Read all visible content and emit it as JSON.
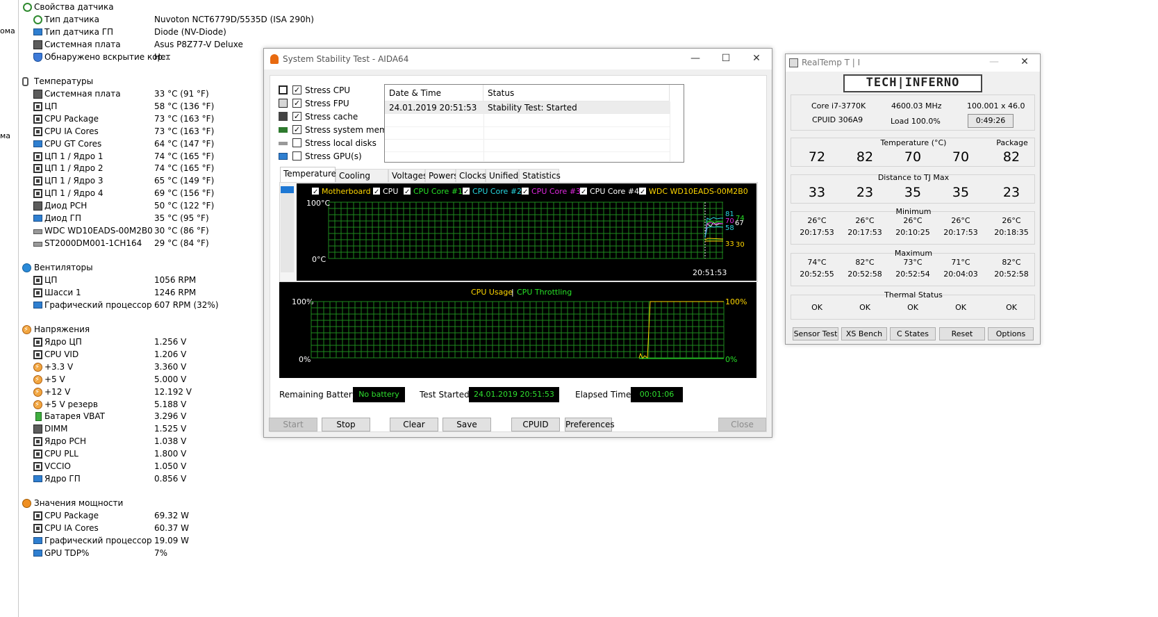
{
  "left_cut": [
    "ома",
    "ма"
  ],
  "sensors": {
    "props_title": "Свойства датчика",
    "props": [
      {
        "label": "Тип датчика",
        "value": "Nuvoton NCT6779D/5535D  (ISA 290h)",
        "icon": "sensor-icon"
      },
      {
        "label": "Тип датчика ГП",
        "value": "Diode  (NV-Diode)",
        "icon": "monitor-icon"
      },
      {
        "label": "Системная плата",
        "value": "Asus P8Z77-V Deluxe",
        "icon": "motherboard-icon"
      },
      {
        "label": "Обнаружено вскрытие кор...",
        "value": "Нет",
        "icon": "shield-icon"
      }
    ],
    "temps_title": "Температуры",
    "temps": [
      {
        "label": "Системная плата",
        "value": "33 °C  (91 °F)"
      },
      {
        "label": "ЦП",
        "value": "58 °C  (136 °F)"
      },
      {
        "label": "CPU Package",
        "value": "73 °C  (163 °F)"
      },
      {
        "label": "CPU IA Cores",
        "value": "73 °C  (163 °F)"
      },
      {
        "label": "CPU GT Cores",
        "value": "64 °C  (147 °F)"
      },
      {
        "label": "ЦП 1 / Ядро 1",
        "value": "74 °C  (165 °F)"
      },
      {
        "label": "ЦП 1 / Ядро 2",
        "value": "74 °C  (165 °F)"
      },
      {
        "label": "ЦП 1 / Ядро 3",
        "value": "65 °C  (149 °F)"
      },
      {
        "label": "ЦП 1 / Ядро 4",
        "value": "69 °C  (156 °F)"
      },
      {
        "label": "Диод PCH",
        "value": "50 °C  (122 °F)"
      },
      {
        "label": "Диод ГП",
        "value": "35 °C  (95 °F)"
      },
      {
        "label": "WDC WD10EADS-00M2B0",
        "value": "30 °C  (86 °F)"
      },
      {
        "label": "ST2000DM001-1CH164",
        "value": "29 °C  (84 °F)"
      }
    ],
    "fans_title": "Вентиляторы",
    "fans": [
      {
        "label": "ЦП",
        "value": "1056 RPM"
      },
      {
        "label": "Шасси 1",
        "value": "1246 RPM"
      },
      {
        "label": "Графический процессор",
        "value": "607 RPM  (32%)"
      }
    ],
    "volts_title": "Напряжения",
    "volts": [
      {
        "label": "Ядро ЦП",
        "value": "1.256 V"
      },
      {
        "label": "CPU VID",
        "value": "1.206 V"
      },
      {
        "label": "+3.3 V",
        "value": "3.360 V"
      },
      {
        "label": "+5 V",
        "value": "5.000 V"
      },
      {
        "label": "+12 V",
        "value": "12.192 V"
      },
      {
        "label": "+5 V резерв",
        "value": "5.188 V"
      },
      {
        "label": "Батарея VBAT",
        "value": "3.296 V"
      },
      {
        "label": "DIMM",
        "value": "1.525 V"
      },
      {
        "label": "Ядро PCH",
        "value": "1.038 V"
      },
      {
        "label": "CPU PLL",
        "value": "1.800 V"
      },
      {
        "label": "VCCIO",
        "value": "1.050 V"
      },
      {
        "label": "Ядро ГП",
        "value": "0.856 V"
      }
    ],
    "power_title": "Значения мощности",
    "power": [
      {
        "label": "CPU Package",
        "value": "69.32 W"
      },
      {
        "label": "CPU IA Cores",
        "value": "60.37 W"
      },
      {
        "label": "Графический процессор",
        "value": "19.09 W"
      },
      {
        "label": "GPU TDP%",
        "value": "7%"
      }
    ]
  },
  "aida": {
    "title": "System Stability Test - AIDA64",
    "stress": [
      {
        "label": "Stress CPU",
        "checked": true
      },
      {
        "label": "Stress FPU",
        "checked": true
      },
      {
        "label": "Stress cache",
        "checked": true
      },
      {
        "label": "Stress system memory",
        "checked": true
      },
      {
        "label": "Stress local disks",
        "checked": false
      },
      {
        "label": "Stress GPU(s)",
        "checked": false
      }
    ],
    "log": {
      "col_date": "Date & Time",
      "col_status": "Status",
      "rows": [
        {
          "date": "24.01.2019 20:51:53",
          "status": "Stability Test: Started"
        }
      ]
    },
    "tabs": [
      "Temperatures",
      "Cooling Fans",
      "Voltages",
      "Powers",
      "Clocks",
      "Unified",
      "Statistics"
    ],
    "temp_graph": {
      "legend": [
        {
          "label": "Motherboard",
          "color": "#ffd700"
        },
        {
          "label": "CPU",
          "color": "#ffffff"
        },
        {
          "label": "CPU Core #1",
          "color": "#27e027"
        },
        {
          "label": "CPU Core #2",
          "color": "#27d7e0"
        },
        {
          "label": "CPU Core #3",
          "color": "#e027e0"
        },
        {
          "label": "CPU Core #4",
          "color": "#ffffff"
        },
        {
          "label": "WDC WD10EADS-00M2B0",
          "color": "#ffd700"
        }
      ],
      "y_top": "100°C",
      "y_bottom": "0°C",
      "time": "20:51:53",
      "readouts": [
        {
          "text": "81",
          "color": "#27d7e0"
        },
        {
          "text": "74",
          "color": "#27e027"
        },
        {
          "text": "70",
          "color": "#e027e0"
        },
        {
          "text": "67",
          "color": "#ffffff"
        },
        {
          "text": "58",
          "color": "#27d7e0"
        },
        {
          "text": "33",
          "color": "#ffd700"
        },
        {
          "text": "30",
          "color": "#ffd700"
        }
      ]
    },
    "cpu_graph": {
      "title_usage": "CPU Usage",
      "sep": "|",
      "title_throttle": "CPU Throttling",
      "y_top_left": "100%",
      "y_bottom_left": "0%",
      "y_top_right": "100%",
      "y_bottom_right": "0%"
    },
    "status": {
      "battery_label": "Remaining Battery:",
      "battery_value": "No battery",
      "started_label": "Test Started:",
      "started_value": "24.01.2019 20:51:53",
      "elapsed_label": "Elapsed Time:",
      "elapsed_value": "00:01:06"
    },
    "buttons": {
      "start": "Start",
      "stop": "Stop",
      "clear": "Clear",
      "save": "Save",
      "cpuid": "CPUID",
      "preferences": "Preferences",
      "close": "Close"
    }
  },
  "realtemp": {
    "title": "RealTemp T | I",
    "logo": "TECH|INFERNO",
    "cpu": "Core i7-3770K",
    "freq": "4600.03 MHz",
    "mult": "100.001 x 46.0",
    "cpuid": "CPUID 306A9",
    "load": "Load 100.0%",
    "time": "0:49:26",
    "temp_title": "Temperature (°C)",
    "package_label": "Package",
    "temps": [
      "72",
      "82",
      "70",
      "70",
      "82"
    ],
    "dist_title": "Distance to TJ Max",
    "dist": [
      "33",
      "23",
      "35",
      "35",
      "23"
    ],
    "min_title": "Minimum",
    "min": [
      {
        "t": "26°C",
        "time": "20:17:53"
      },
      {
        "t": "26°C",
        "time": "20:17:53"
      },
      {
        "t": "26°C",
        "time": "20:10:25"
      },
      {
        "t": "26°C",
        "time": "20:17:53"
      },
      {
        "t": "26°C",
        "time": "20:18:35"
      }
    ],
    "max_title": "Maximum",
    "max": [
      {
        "t": "74°C",
        "time": "20:52:55"
      },
      {
        "t": "82°C",
        "time": "20:52:58"
      },
      {
        "t": "73°C",
        "time": "20:52:54"
      },
      {
        "t": "71°C",
        "time": "20:04:03"
      },
      {
        "t": "82°C",
        "time": "20:52:58"
      }
    ],
    "thermal_title": "Thermal Status",
    "thermal": [
      "OK",
      "OK",
      "OK",
      "OK",
      "OK"
    ],
    "buttons": [
      "Sensor Test",
      "XS Bench",
      "C States",
      "Reset",
      "Options"
    ]
  }
}
